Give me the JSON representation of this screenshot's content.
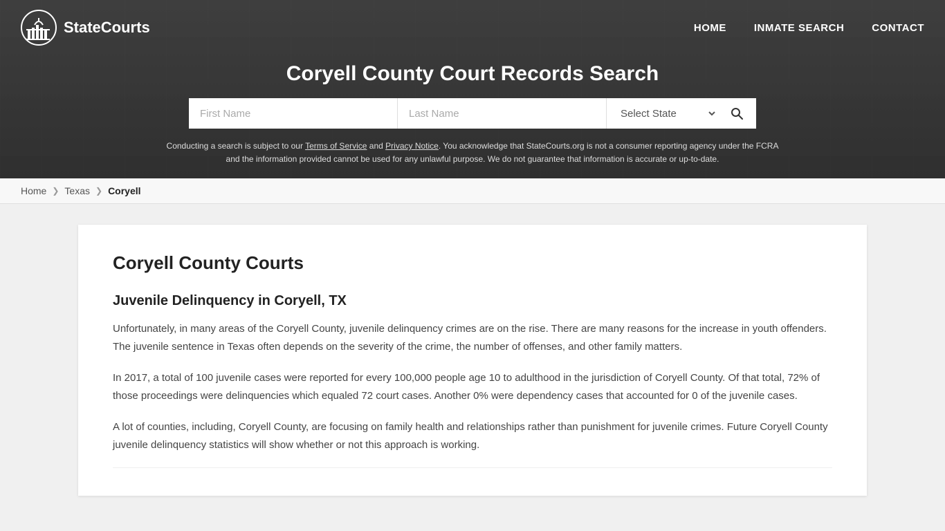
{
  "site": {
    "logo_text": "StateCourts",
    "logo_icon": "⛉"
  },
  "nav": {
    "home_label": "HOME",
    "inmate_search_label": "INMATE SEARCH",
    "contact_label": "CONTACT"
  },
  "header": {
    "title": "Coryell County Court Records Search",
    "first_name_placeholder": "First Name",
    "last_name_placeholder": "Last Name",
    "state_select_default": "Select State",
    "disclaimer": "Conducting a search is subject to our Terms of Service and Privacy Notice. You acknowledge that StateCourts.org is not a consumer reporting agency under the FCRA and the information provided cannot be used for any unlawful purpose. We do not guarantee that information is accurate or up-to-date."
  },
  "breadcrumb": {
    "home": "Home",
    "state": "Texas",
    "county": "Coryell"
  },
  "content": {
    "heading": "Coryell County Courts",
    "section1_heading": "Juvenile Delinquency in Coryell, TX",
    "para1": "Unfortunately, in many areas of the Coryell County, juvenile delinquency crimes are on the rise. There are many reasons for the increase in youth offenders. The juvenile sentence in Texas often depends on the severity of the crime, the number of offenses, and other family matters.",
    "para2": "In 2017, a total of 100 juvenile cases were reported for every 100,000 people age 10 to adulthood in the jurisdiction of Coryell County. Of that total, 72% of those proceedings were delinquencies which equaled 72 court cases. Another 0% were dependency cases that accounted for 0 of the juvenile cases.",
    "para3": "A lot of counties, including, Coryell County, are focusing on family health and relationships rather than punishment for juvenile crimes. Future Coryell County juvenile delinquency statistics will show whether or not this approach is working."
  }
}
